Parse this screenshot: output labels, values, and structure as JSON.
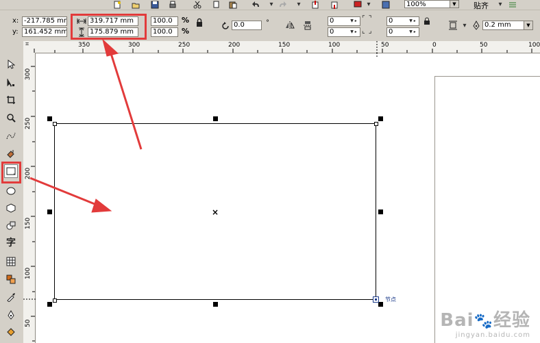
{
  "standard_toolbar": {
    "zoom_value": "100%",
    "snap_label": "贴齐"
  },
  "property_bar": {
    "x_label": "x:",
    "x_value": "-217.785 mm",
    "y_label": "y:",
    "y_value": "161.452 mm",
    "width_value": "319.717 mm",
    "height_value": "175.879 mm",
    "scale_w_value": "100.0",
    "scale_h_value": "100.0",
    "percent": "%",
    "rotation_value": "0.0",
    "degree_symbol": "°",
    "corner_tl": "0",
    "corner_bl": "0",
    "corner_tr": "0",
    "corner_br": "0",
    "outline_width": "0.2 mm"
  },
  "ruler_top": {
    "labels": [
      "350",
      "300",
      "250",
      "200",
      "150",
      "100",
      "50",
      "0",
      "50",
      "100"
    ]
  },
  "ruler_left": {
    "labels": [
      "300",
      "250",
      "200",
      "150",
      "100",
      "50"
    ]
  },
  "canvas": {
    "node_tag": "节点"
  },
  "watermark": {
    "brand": "Bai",
    "brand_icon": "paw-icon",
    "brand_cn": "经验",
    "url": "jingyan.baidu.com"
  },
  "colors": {
    "highlight": "#e23b3b",
    "chrome": "#d4d0c8",
    "canvas": "#ffffff"
  }
}
